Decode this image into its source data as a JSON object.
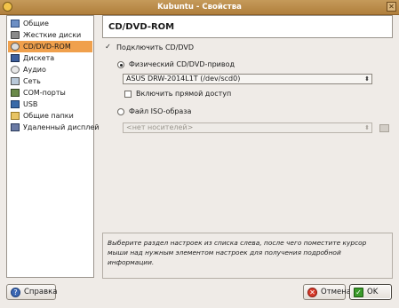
{
  "window": {
    "title": "Kubuntu - Свойства",
    "close_glyph": "✕"
  },
  "sidebar": {
    "items": [
      {
        "label": "Общие",
        "icon": "general-icon"
      },
      {
        "label": "Жесткие диски",
        "icon": "hard-disk-icon"
      },
      {
        "label": "CD/DVD-ROM",
        "icon": "cd-icon"
      },
      {
        "label": "Дискета",
        "icon": "floppy-icon"
      },
      {
        "label": "Аудио",
        "icon": "audio-icon"
      },
      {
        "label": "Сеть",
        "icon": "network-icon"
      },
      {
        "label": "COM-порты",
        "icon": "serial-port-icon"
      },
      {
        "label": "USB",
        "icon": "usb-icon"
      },
      {
        "label": "Общие папки",
        "icon": "shared-folder-icon"
      },
      {
        "label": "Удаленный дисплей",
        "icon": "remote-display-icon"
      }
    ],
    "selected_index": 2,
    "selected_color": "#f0a04c"
  },
  "page": {
    "title": "CD/DVD-ROM",
    "mount_checkbox": {
      "label": "Подключить CD/DVD",
      "checked": true,
      "glyph": "✓"
    },
    "host_drive_radio": {
      "label": "Физический CD/DVD-привод",
      "selected": true
    },
    "host_drive_combo": {
      "value": "ASUS DRW-2014L1T (/dev/scd0)",
      "arrow": "⬍"
    },
    "passthrough_checkbox": {
      "label": "Включить прямой доступ",
      "checked": false
    },
    "iso_radio": {
      "label": "Файл ISO-образа",
      "selected": false
    },
    "iso_combo": {
      "value": "<нет носителей>",
      "arrow": "⬍",
      "enabled": false
    }
  },
  "info": {
    "text": "Выберите раздел настроек из списка слева, после чего поместите курсор мыши над нужным элементом настроек для получения подробной информации."
  },
  "buttons": {
    "help": {
      "label": "Справка",
      "glyph": "?"
    },
    "cancel": {
      "label": "Отмена",
      "glyph": "✕"
    },
    "ok": {
      "label": "OK",
      "glyph": "✓"
    }
  },
  "colors": {
    "titlebar": "#b8873f",
    "background": "#efebe7"
  }
}
